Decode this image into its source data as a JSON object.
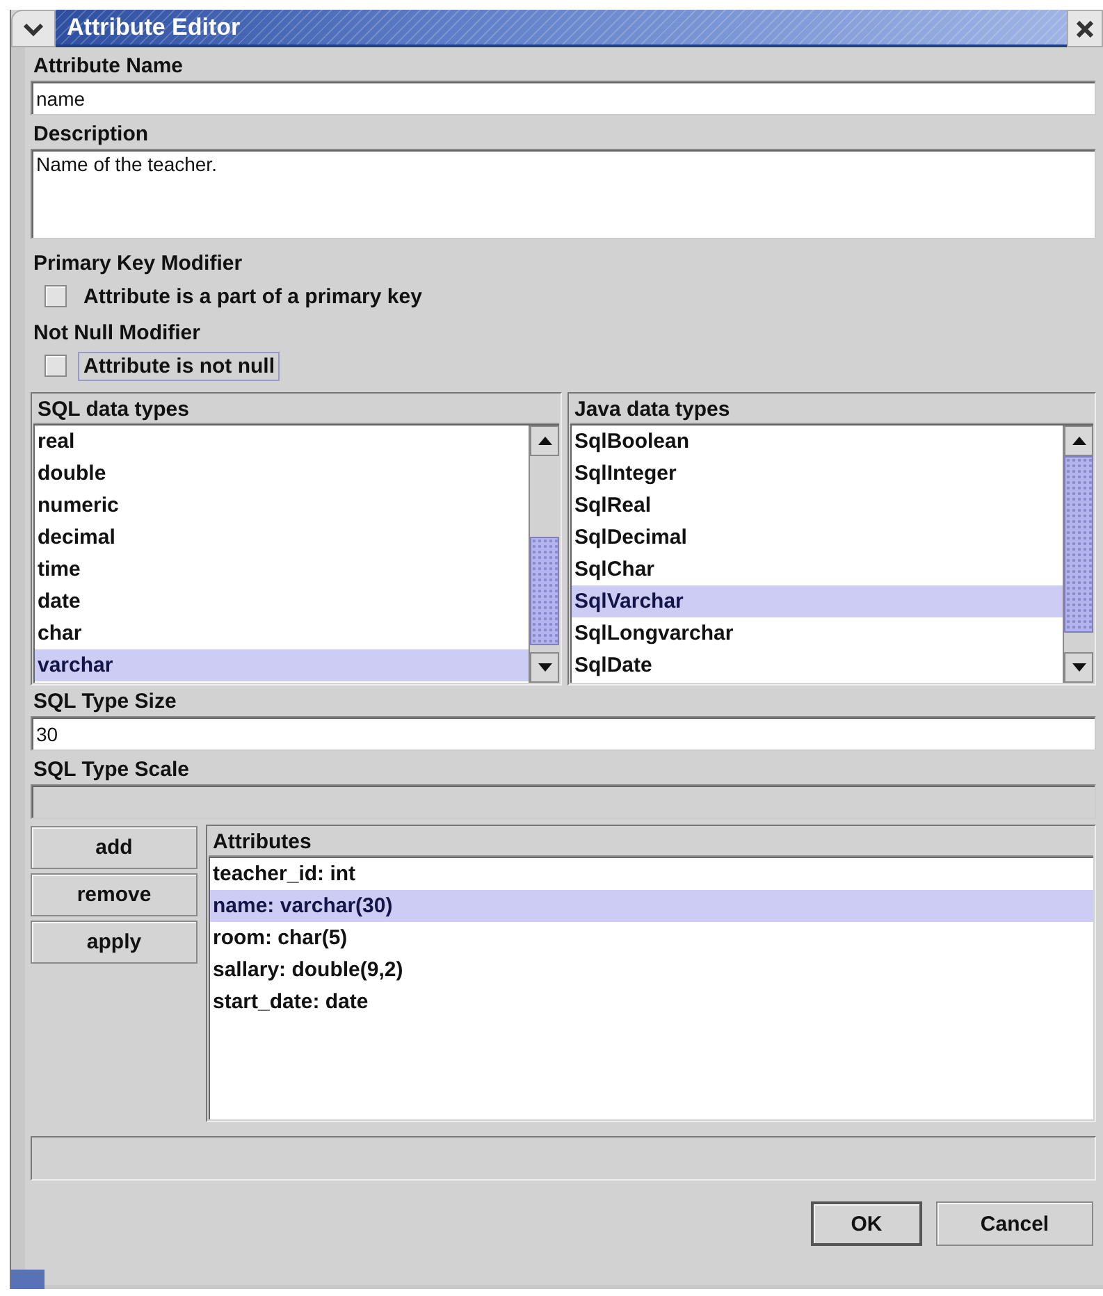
{
  "window": {
    "title": "Attribute Editor"
  },
  "attribute_name": {
    "label": "Attribute Name",
    "value": "name"
  },
  "description": {
    "label": "Description",
    "value": "Name of the teacher."
  },
  "modifiers": [
    {
      "heading": "Primary Key Modifier",
      "label": "Attribute is a part of a primary key",
      "checked": false,
      "focused": false
    },
    {
      "heading": "Not Null Modifier",
      "label": "Attribute is not null",
      "checked": false,
      "focused": true
    }
  ],
  "type_lists": [
    {
      "title": "SQL data types",
      "items": [
        {
          "label": "real",
          "selected": false
        },
        {
          "label": "double",
          "selected": false
        },
        {
          "label": "numeric",
          "selected": false
        },
        {
          "label": "decimal",
          "selected": false
        },
        {
          "label": "time",
          "selected": false
        },
        {
          "label": "date",
          "selected": false
        },
        {
          "label": "char",
          "selected": false
        },
        {
          "label": "varchar",
          "selected": true
        }
      ]
    },
    {
      "title": "Java data types",
      "items": [
        {
          "label": "SqlBoolean",
          "selected": false
        },
        {
          "label": "SqlInteger",
          "selected": false
        },
        {
          "label": "SqlReal",
          "selected": false
        },
        {
          "label": "SqlDecimal",
          "selected": false
        },
        {
          "label": "SqlChar",
          "selected": false
        },
        {
          "label": "SqlVarchar",
          "selected": true
        },
        {
          "label": "SqlLongvarchar",
          "selected": false
        },
        {
          "label": "SqlDate",
          "selected": false
        }
      ]
    }
  ],
  "sql_type_size": {
    "label": "SQL Type Size",
    "value": "30"
  },
  "sql_type_scale": {
    "label": "SQL Type Scale",
    "disabled": true
  },
  "side_buttons": [
    "add",
    "remove",
    "apply"
  ],
  "attributes": {
    "title": "Attributes",
    "items": [
      {
        "label": "teacher_id: int",
        "selected": false
      },
      {
        "label": "name: varchar(30)",
        "selected": true
      },
      {
        "label": "room: char(5)",
        "selected": false
      },
      {
        "label": "sallary: double(9,2)",
        "selected": false
      },
      {
        "label": "start_date: date",
        "selected": false
      }
    ]
  },
  "dialog_buttons": [
    {
      "label": "OK",
      "default": true
    },
    {
      "label": "Cancel",
      "default": false
    }
  ]
}
